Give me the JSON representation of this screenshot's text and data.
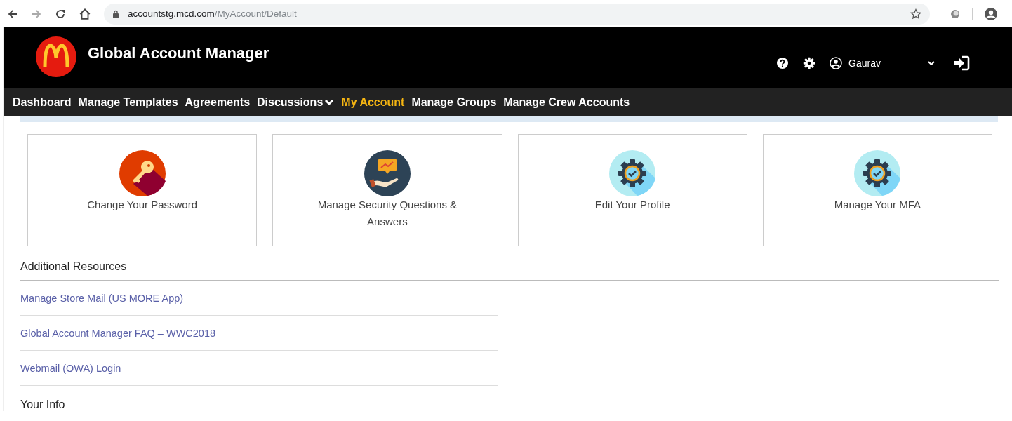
{
  "browser": {
    "url_host": "accountstg.mcd.com",
    "url_path": "/MyAccount/Default"
  },
  "header": {
    "title": "Global Account Manager",
    "user": "Gaurav"
  },
  "nav": [
    {
      "label": "Dashboard",
      "selected": false,
      "dropdown": false
    },
    {
      "label": "Manage Templates",
      "selected": false,
      "dropdown": false
    },
    {
      "label": "Agreements",
      "selected": false,
      "dropdown": false
    },
    {
      "label": "Discussions",
      "selected": false,
      "dropdown": true
    },
    {
      "label": "My Account",
      "selected": true,
      "dropdown": false
    },
    {
      "label": "Manage Groups",
      "selected": false,
      "dropdown": false
    },
    {
      "label": "Manage Crew Accounts",
      "selected": false,
      "dropdown": false
    }
  ],
  "cards": [
    {
      "label": "Change Your Password",
      "kind": "key"
    },
    {
      "label": "Manage Security Questions & Answers",
      "kind": "hand"
    },
    {
      "label": "Edit Your Profile",
      "kind": "gear"
    },
    {
      "label": "Manage Your MFA",
      "kind": "gear"
    }
  ],
  "resources": {
    "title": "Additional Resources",
    "links": [
      "Manage Store Mail (US MORE App)",
      "Global Account Manager FAQ – WWC2018",
      "Webmail (OWA) Login"
    ]
  },
  "your_info": {
    "title": "Your Info"
  }
}
